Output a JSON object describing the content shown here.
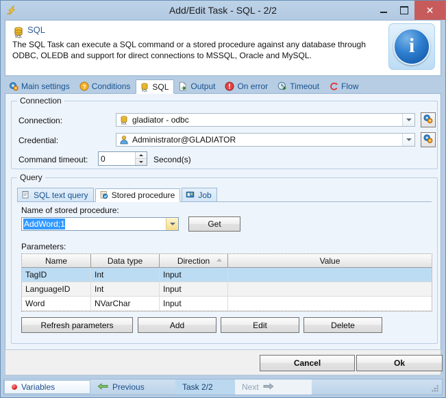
{
  "window": {
    "title": "Add/Edit Task - SQL - 2/2",
    "icon": "lightning-bolt-icon",
    "buttons": {
      "minimize": "minimize-button",
      "maximize": "maximize-button",
      "close": "close-button",
      "close_glyph": "✕"
    }
  },
  "header": {
    "title": "SQL",
    "icon": "sql-database-icon",
    "description": "The SQL Task can execute a SQL command or a stored procedure against any database through ODBC, OLEDB and support for direct connections to MSSQL, Oracle and MySQL.",
    "info_icon": "info-badge-icon",
    "info_glyph": "i"
  },
  "tabs": [
    {
      "label": "Main settings",
      "icon": "gear-icon",
      "active": false
    },
    {
      "label": "Conditions",
      "icon": "question-mark-icon",
      "active": false
    },
    {
      "label": "SQL",
      "icon": "sql-database-icon",
      "active": true
    },
    {
      "label": "Output",
      "icon": "document-export-icon",
      "active": false
    },
    {
      "label": "On error",
      "icon": "error-exclamation-icon",
      "active": false
    },
    {
      "label": "Timeout",
      "icon": "clock-export-icon",
      "active": false
    },
    {
      "label": "Flow",
      "icon": "flow-arrow-icon",
      "active": false
    }
  ],
  "connection_group": {
    "title": "Connection",
    "connection": {
      "label": "Connection:",
      "value": "gladiator - odbc",
      "icon": "sql-database-icon",
      "browse_icon": "gears-icon"
    },
    "credential": {
      "label": "Credential:",
      "value": "Administrator@GLADIATOR",
      "icon": "user-icon",
      "browse_icon": "gears-icon"
    },
    "command_timeout": {
      "label": "Command timeout:",
      "value": "0",
      "unit": "Second(s)"
    }
  },
  "query_group": {
    "title": "Query",
    "tabs": [
      {
        "label": "SQL text query",
        "icon": "notepad-icon",
        "active": false
      },
      {
        "label": "Stored procedure",
        "icon": "stored-procedure-icon",
        "active": true
      },
      {
        "label": "Job",
        "icon": "job-icon",
        "active": false
      }
    ],
    "stored_procedure": {
      "label": "Name of stored procedure:",
      "value": "AddWord;1",
      "get_button": "Get"
    },
    "parameters": {
      "label": "Parameters:",
      "columns": [
        "Name",
        "Data type",
        "Direction",
        "Value"
      ],
      "sorted_column": "Direction",
      "rows": [
        {
          "name": "TagID",
          "data_type": "Int",
          "direction": "Input",
          "value": "",
          "selected": true
        },
        {
          "name": "LanguageID",
          "data_type": "Int",
          "direction": "Input",
          "value": "",
          "selected": false
        },
        {
          "name": "Word",
          "data_type": "NVarChar",
          "direction": "Input",
          "value": "",
          "selected": false
        }
      ]
    },
    "actions": [
      {
        "label": "Refresh parameters"
      },
      {
        "label": "Add"
      },
      {
        "label": "Edit"
      },
      {
        "label": "Delete"
      }
    ]
  },
  "footer": {
    "cancel": "Cancel",
    "ok": "Ok"
  },
  "statusbar": {
    "variables": "Variables",
    "variables_icon": "red-dot-icon",
    "previous": "Previous",
    "previous_icon": "arrow-left-icon",
    "task": "Task 2/2",
    "next": "Next",
    "next_icon": "arrow-right-icon",
    "resize_grip": "resize-grip-icon"
  },
  "colors": {
    "window_frame": "#b6cde4",
    "titlebar": "#b7cde4",
    "close_button": "#c75b5b",
    "panel_background": "#eef4fb",
    "accent_link": "#18528f",
    "selection": "#3399ff",
    "grid_selected_row": "#bcdcf4"
  }
}
